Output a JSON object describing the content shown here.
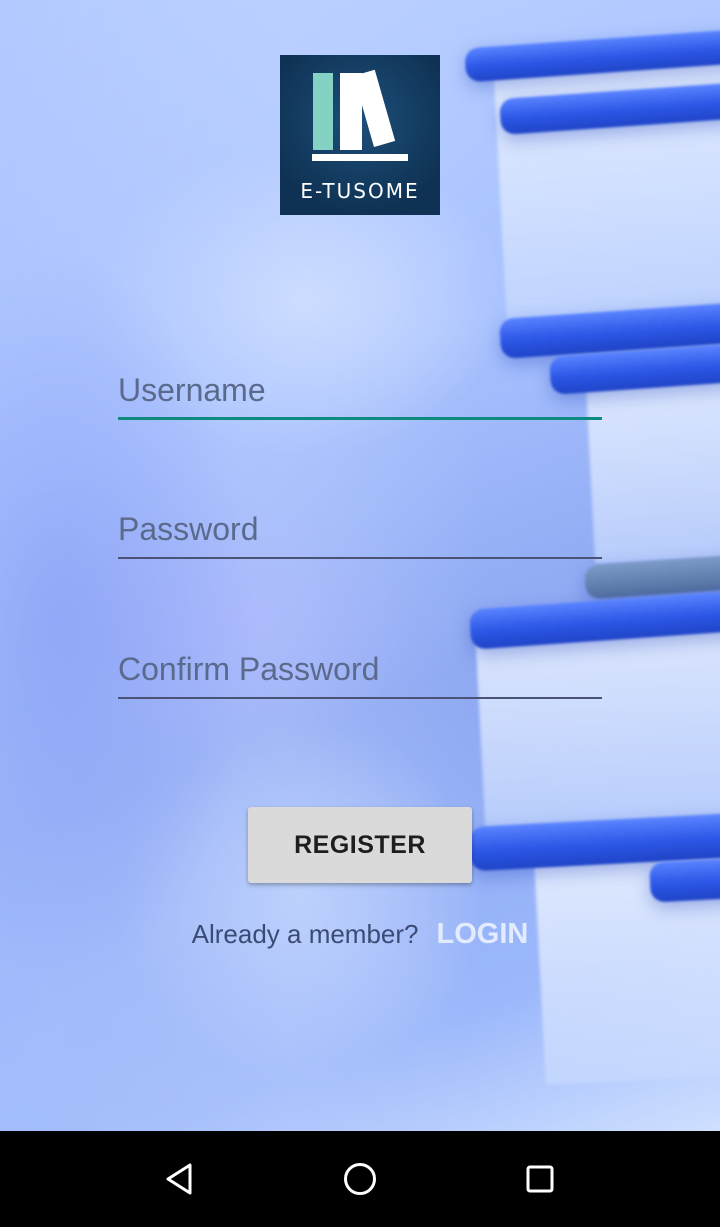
{
  "logo": {
    "text": "E-TUSOME",
    "icon": "books-on-shelf-icon",
    "colors": {
      "background": "#0f3254",
      "accent": "#83d2c4",
      "foreground": "#ffffff"
    }
  },
  "form": {
    "username": {
      "placeholder": "Username",
      "value": ""
    },
    "password": {
      "placeholder": "Password",
      "value": ""
    },
    "confirm_password": {
      "placeholder": "Confirm Password",
      "value": ""
    }
  },
  "buttons": {
    "register_label": "REGISTER"
  },
  "login_prompt": {
    "text": "Already a member?",
    "link": "LOGIN"
  },
  "navbar": {
    "back_icon": "back-triangle-icon",
    "home_icon": "home-circle-icon",
    "recents_icon": "recents-square-icon"
  },
  "colors": {
    "focused_underline": "#0f8a7e",
    "underline": "#4a5275",
    "button_background": "#dadada",
    "login_link": "#e3ecff"
  }
}
